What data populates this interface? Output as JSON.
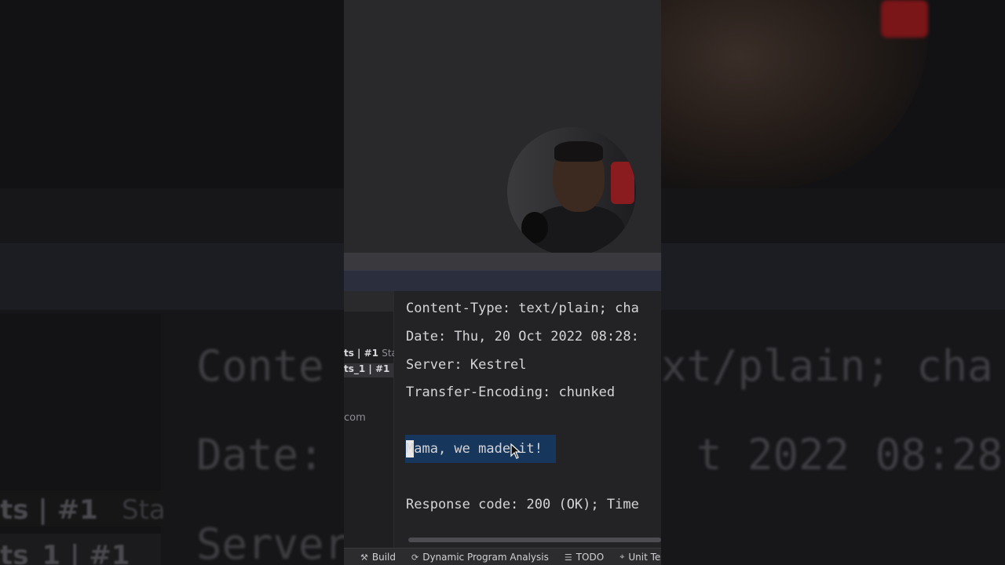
{
  "console": {
    "lines": [
      "Content-Type: text/plain; cha",
      "Date: Thu, 20 Oct 2022 08:28:",
      "Server: Kestrel",
      "Transfer-Encoding: chunked",
      "Mama, we made it!",
      "Response code: 200 (OK); Time"
    ]
  },
  "side_panel": {
    "row1_bold": "ts | #1",
    "row1_dim": "Sta",
    "row2_bold": "ts_1 | #1",
    "url_fragment": "com"
  },
  "statusbar": {
    "items": [
      {
        "icon": "hammer-icon",
        "glyph": "⚒",
        "label": "Build"
      },
      {
        "icon": "profiler-icon",
        "glyph": "⟳",
        "label": "Dynamic Program Analysis"
      },
      {
        "icon": "list-icon",
        "glyph": "☰",
        "label": "TODO"
      },
      {
        "icon": "unit-tests-icon",
        "glyph": "⌖",
        "label": "Unit Tes"
      }
    ]
  },
  "background_echo": {
    "line1_left": "Conte",
    "line1_right": "xt/plain; cha",
    "line2_left": "Date:",
    "line2_right": "t 2022 08:28:",
    "line3_left": "Server",
    "side1": "ts | #1",
    "side1_dim": "Sta",
    "side2": "ts_1 | #1"
  },
  "colors": {
    "selection": "#17365c",
    "editor_bg": "#232326",
    "text": "#d5d5d8"
  }
}
